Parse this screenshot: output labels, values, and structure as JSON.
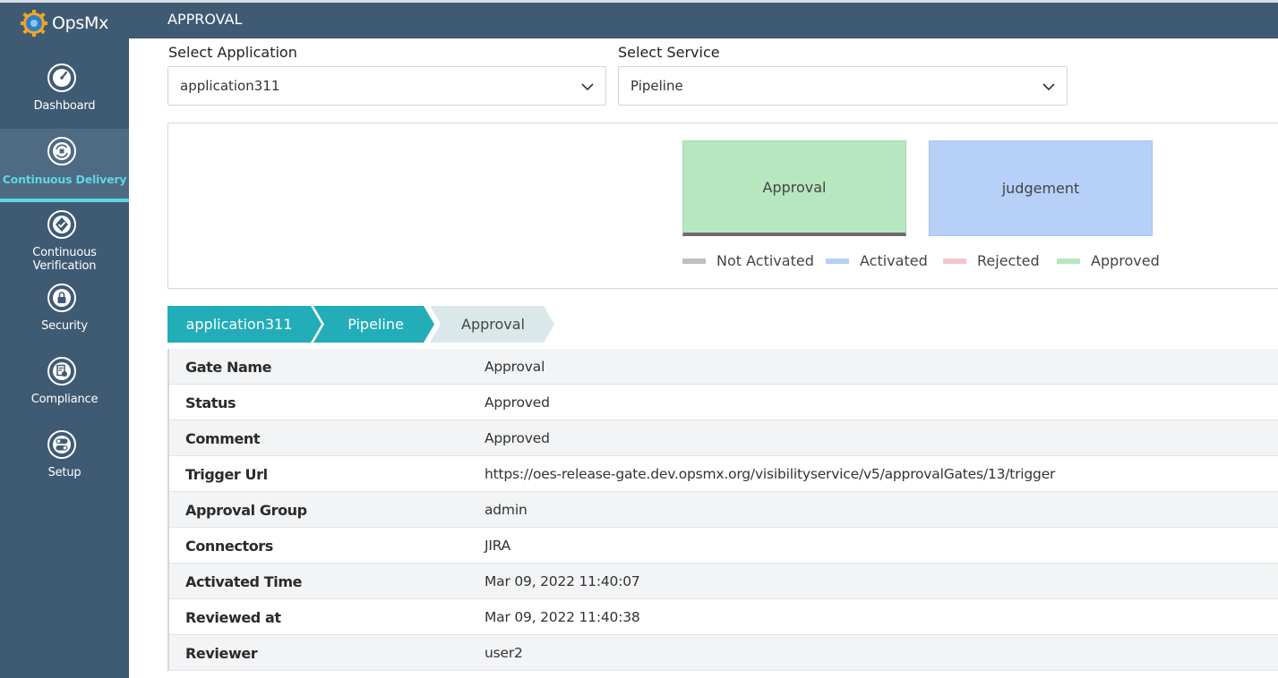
{
  "brand": {
    "name": "OpsMx"
  },
  "sidebar": {
    "items": [
      {
        "label": "Dashboard",
        "icon": "dashboard-icon",
        "active": false
      },
      {
        "label": "Continuous Delivery",
        "icon": "continuous-delivery-icon",
        "active": true
      },
      {
        "label": "Continuous Verification",
        "icon": "verification-icon",
        "active": false
      },
      {
        "label": "Security",
        "icon": "lock-icon",
        "active": false
      },
      {
        "label": "Compliance",
        "icon": "compliance-icon",
        "active": false
      },
      {
        "label": "Setup",
        "icon": "toggle-icon",
        "active": false
      }
    ]
  },
  "header": {
    "title": "APPROVAL"
  },
  "filters": {
    "application": {
      "label": "Select Application",
      "value": "application311"
    },
    "service": {
      "label": "Select Service",
      "value": "Pipeline"
    }
  },
  "gates": [
    {
      "name": "Approval",
      "status": "Approved",
      "color": "#b6e7be"
    },
    {
      "name": "judgement",
      "status": "Activated",
      "color": "#b7d0f7"
    }
  ],
  "legend": [
    {
      "label": "Not Activated",
      "color": "#bfbfbf"
    },
    {
      "label": "Activated",
      "color": "#b7d0f7"
    },
    {
      "label": "Rejected",
      "color": "#f5c6cb"
    },
    {
      "label": "Approved",
      "color": "#b6e7be"
    }
  ],
  "breadcrumb": [
    "application311",
    "Pipeline",
    "Approval"
  ],
  "details": [
    {
      "key": "Gate Name",
      "value": "Approval"
    },
    {
      "key": "Status",
      "value": "Approved"
    },
    {
      "key": "Comment",
      "value": "Approved"
    },
    {
      "key": "Trigger Url",
      "value": "https://oes-release-gate.dev.opsmx.org/visibilityservice/v5/approvalGates/13/trigger"
    },
    {
      "key": "Approval Group",
      "value": "admin"
    },
    {
      "key": "Connectors",
      "value": "JIRA"
    },
    {
      "key": "Activated Time",
      "value": "Mar 09, 2022 11:40:07"
    },
    {
      "key": "Reviewed at",
      "value": "Mar 09, 2022 11:40:38"
    },
    {
      "key": "Reviewer",
      "value": "user2"
    }
  ],
  "colors": {
    "sidebar": "#3f5a73",
    "accent": "#5fd6e6",
    "crumb_active": "#22adb8",
    "crumb_current": "#dbe8ea"
  }
}
